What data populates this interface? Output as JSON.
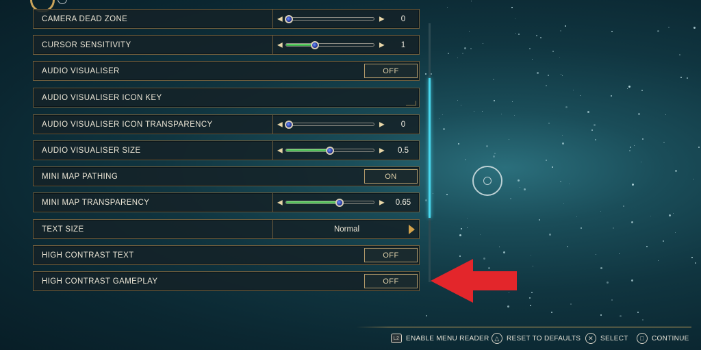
{
  "settings": [
    {
      "label": "CAMERA DEAD ZONE",
      "type": "slider",
      "value": "0",
      "level": 0.0
    },
    {
      "label": "CURSOR SENSITIVITY",
      "type": "slider",
      "value": "1",
      "level": 0.33
    },
    {
      "label": "AUDIO VISUALISER",
      "type": "toggle",
      "value": "OFF"
    },
    {
      "label": "AUDIO VISUALISER ICON KEY",
      "type": "submenu"
    },
    {
      "label": "AUDIO VISUALISER ICON TRANSPARENCY",
      "type": "slider",
      "value": "0",
      "level": 0.0
    },
    {
      "label": "AUDIO VISUALISER SIZE",
      "type": "slider",
      "value": "0.5",
      "level": 0.5
    },
    {
      "label": "MINI MAP PATHING",
      "type": "toggle",
      "value": "ON"
    },
    {
      "label": "MINI MAP TRANSPARENCY",
      "type": "slider",
      "value": "0.65",
      "level": 0.61
    },
    {
      "label": "TEXT SIZE",
      "type": "select",
      "value": "Normal"
    },
    {
      "label": "HIGH CONTRAST TEXT",
      "type": "toggle",
      "value": "OFF"
    },
    {
      "label": "HIGH CONTRAST GAMEPLAY",
      "type": "toggle",
      "value": "OFF"
    }
  ],
  "scrollbar": {
    "color": "#49d8ee",
    "position": 0.46
  },
  "annotation": {
    "icon": "red-arrow-icon",
    "color": "#e3262b"
  },
  "footer": {
    "enable_menu_reader": {
      "glyph": "L2",
      "label": "ENABLE MENU READER"
    },
    "reset_to_defaults": {
      "glyph": "△",
      "label": "RESET TO DEFAULTS"
    },
    "select": {
      "glyph": "✕",
      "label": "SELECT"
    },
    "continue": {
      "glyph": "□",
      "label": "CONTINUE"
    }
  }
}
